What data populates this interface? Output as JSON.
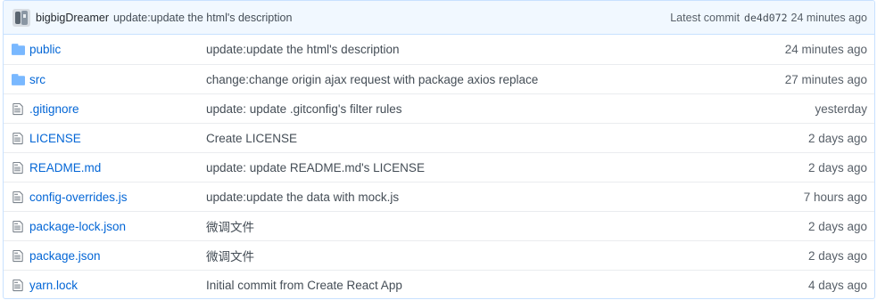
{
  "commit": {
    "author": "bigbigDreamer",
    "message": "update:update the html's description",
    "latest_label": "Latest commit",
    "sha": "de4d072",
    "age": "24 minutes ago"
  },
  "files": [
    {
      "name": "public",
      "type": "dir",
      "icon": "folder-icon",
      "message": "update:update the html's description",
      "age": "24 minutes ago"
    },
    {
      "name": "src",
      "type": "dir",
      "icon": "folder-icon",
      "message": "change:change origin ajax request with package axios replace",
      "age": "27 minutes ago"
    },
    {
      "name": ".gitignore",
      "type": "file",
      "icon": "file-icon",
      "message": "update: update .gitconfig's filter rules",
      "age": "yesterday"
    },
    {
      "name": "LICENSE",
      "type": "file",
      "icon": "file-icon",
      "message": "Create LICENSE",
      "age": "2 days ago"
    },
    {
      "name": "README.md",
      "type": "file",
      "icon": "file-icon",
      "message": "update: update README.md's LICENSE",
      "age": "2 days ago"
    },
    {
      "name": "config-overrides.js",
      "type": "file",
      "icon": "file-icon",
      "message": "update:update the data with mock.js",
      "age": "7 hours ago"
    },
    {
      "name": "package-lock.json",
      "type": "file",
      "icon": "file-icon",
      "message": "微调文件",
      "age": "2 days ago"
    },
    {
      "name": "package.json",
      "type": "file",
      "icon": "file-icon",
      "message": "微调文件",
      "age": "2 days ago"
    },
    {
      "name": "yarn.lock",
      "type": "file",
      "icon": "file-icon",
      "message": "Initial commit from Create React App",
      "age": "4 days ago"
    }
  ],
  "colors": {
    "link": "#0366d6",
    "folder": "#79b8ff",
    "file_icon": "#6a737d",
    "header_bg": "#f1f8ff"
  }
}
